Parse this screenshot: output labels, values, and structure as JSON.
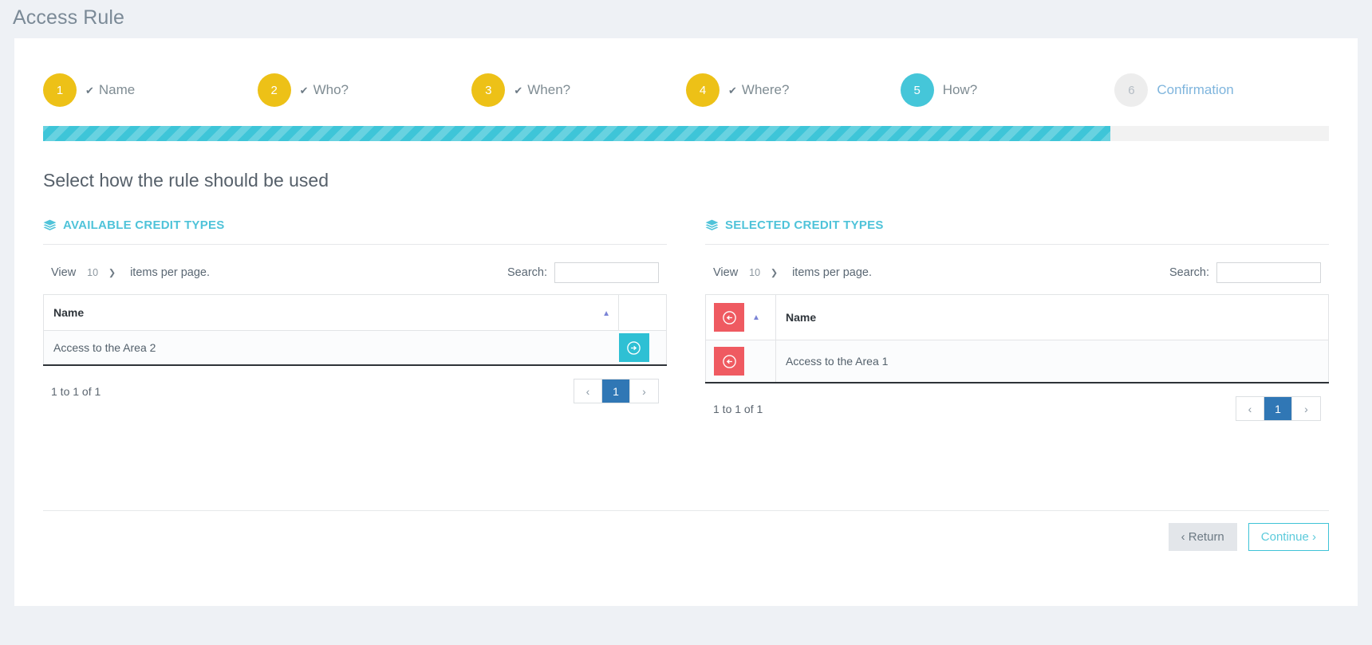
{
  "page": {
    "title": "Access Rule",
    "section_heading": "Select how the rule should be used"
  },
  "stepper": {
    "steps": [
      {
        "number": "1",
        "label": "Name",
        "state": "done",
        "check": "✔"
      },
      {
        "number": "2",
        "label": "Who?",
        "state": "done",
        "check": "✔"
      },
      {
        "number": "3",
        "label": "When?",
        "state": "done",
        "check": "✔"
      },
      {
        "number": "4",
        "label": "Where?",
        "state": "done",
        "check": "✔"
      },
      {
        "number": "5",
        "label": "How?",
        "state": "active",
        "check": ""
      },
      {
        "number": "6",
        "label": "Confirmation",
        "state": "todo",
        "check": ""
      }
    ]
  },
  "progress": {
    "percent": 83,
    "fill_color": "#3ec5d8",
    "track_color": "#f2f2f2"
  },
  "available_panel": {
    "heading": "AVAILABLE CREDIT TYPES",
    "icon": "layers-icon",
    "view_label": "View",
    "page_size": "10",
    "items_per_page_label": "items per page.",
    "search_label": "Search:",
    "search_value": "",
    "search_placeholder": "",
    "column_name": "Name",
    "sort_indicator": "▲",
    "rows": [
      {
        "name": "Access to the Area 2",
        "action_icon": "arrow-right-circle-icon"
      }
    ],
    "footer_info": "1 to 1 of 1",
    "pager": {
      "prev": "‹",
      "pages": [
        "1"
      ],
      "next": "›",
      "active": "1"
    }
  },
  "selected_panel": {
    "heading": "SELECTED CREDIT TYPES",
    "icon": "layers-icon",
    "view_label": "View",
    "page_size": "10",
    "items_per_page_label": "items per page.",
    "search_label": "Search:",
    "search_value": "",
    "search_placeholder": "",
    "column_name": "Name",
    "sort_indicator": "▲",
    "header_action_icon": "arrow-left-circle-icon",
    "rows": [
      {
        "name": "Access to the Area 1",
        "action_icon": "arrow-left-circle-icon"
      }
    ],
    "footer_info": "1 to 1 of 1",
    "pager": {
      "prev": "‹",
      "pages": [
        "1"
      ],
      "next": "›",
      "active": "1"
    }
  },
  "footer": {
    "return_label": "‹ Return",
    "continue_label": "Continue ›"
  },
  "colors": {
    "accent_teal": "#45c6d9",
    "step_done_yellow": "#edc117",
    "remove_red": "#ef5a61",
    "pager_active_blue": "#3077b5"
  }
}
